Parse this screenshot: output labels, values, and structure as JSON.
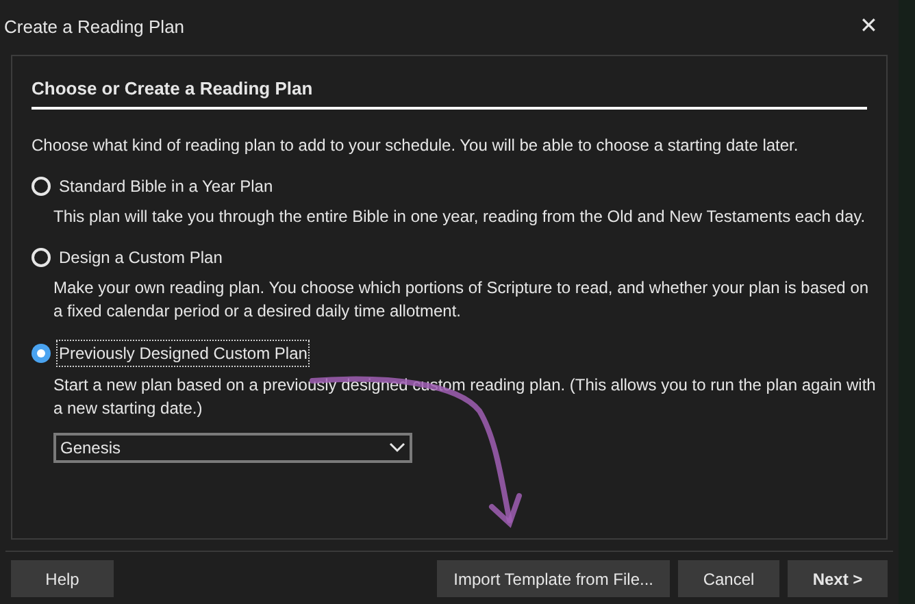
{
  "window": {
    "title": "Create a Reading Plan",
    "close": "✕"
  },
  "section": {
    "heading": "Choose or Create a Reading Plan",
    "intro": "Choose what kind of reading plan to add to your schedule. You will be able to choose a starting date later."
  },
  "options": [
    {
      "label": "Standard Bible in a Year Plan",
      "selected": false,
      "description": "This plan will take you through the entire Bible in one year, reading from the Old and New Testaments each day."
    },
    {
      "label": "Design a Custom Plan",
      "selected": false,
      "description": "Make your own reading plan. You choose which portions of Scripture to read, and whether your plan is based on a fixed calendar period or a desired daily time allotment."
    },
    {
      "label": "Previously Designed Custom Plan",
      "selected": true,
      "description": "Start a new plan based on a previously designed custom reading plan. (This allows you to run the plan again with a new starting date.)",
      "dropdown": {
        "value": "Genesis"
      }
    }
  ],
  "buttons": [
    {
      "label": "Help",
      "kind": "left"
    },
    {
      "label": "Import Template from File...",
      "kind": "right"
    },
    {
      "label": "Cancel",
      "kind": "right"
    },
    {
      "label": "Next >",
      "kind": "primary"
    }
  ]
}
